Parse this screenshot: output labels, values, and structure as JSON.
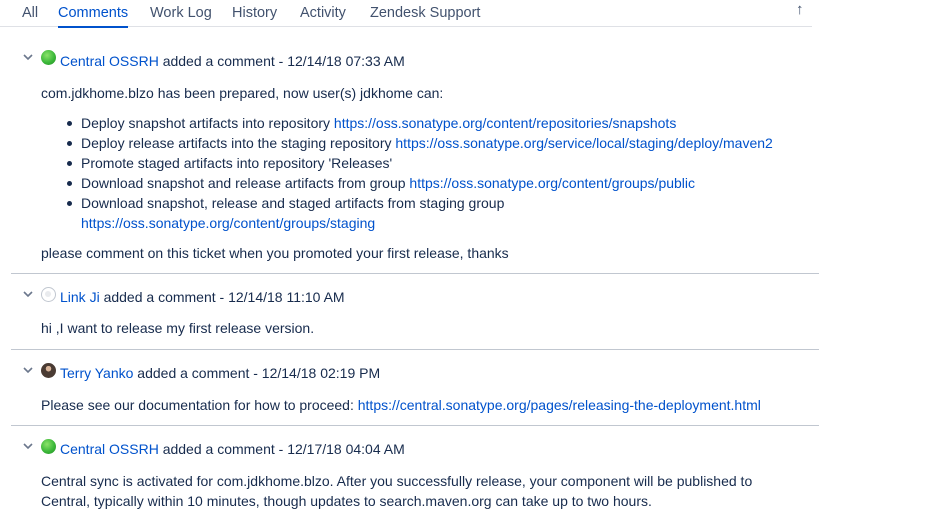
{
  "tabs": [
    {
      "label": "All"
    },
    {
      "label": "Comments"
    },
    {
      "label": "Work Log"
    },
    {
      "label": "History"
    },
    {
      "label": "Activity"
    },
    {
      "label": "Zendesk Support"
    }
  ],
  "sort_icon": "↑",
  "comments": [
    {
      "author": "Central OSSRH",
      "meta": "added a comment - 12/14/18 07:33 AM",
      "intro": "com.jdkhome.blzo has been prepared, now user(s) jdkhome can:",
      "items": [
        {
          "text": "Deploy snapshot artifacts into repository ",
          "link": "https://oss.sonatype.org/content/repositories/snapshots"
        },
        {
          "text": "Deploy release artifacts into the staging repository ",
          "link": "https://oss.sonatype.org/service/local/staging/deploy/maven2"
        },
        {
          "text": "Promote staged artifacts into repository 'Releases'",
          "link": ""
        },
        {
          "text": "Download snapshot and release artifacts from group ",
          "link": "https://oss.sonatype.org/content/groups/public"
        },
        {
          "text": "Download snapshot, release and staged artifacts from staging group",
          "link": "https://oss.sonatype.org/content/groups/staging"
        }
      ],
      "outro": "please comment on this ticket when you promoted your first release, thanks"
    },
    {
      "author": "Link Ji",
      "meta": "added a comment - 12/14/18 11:10 AM",
      "text": "hi ,I want to release my first release version."
    },
    {
      "author": "Terry Yanko",
      "meta": "added a comment - 12/14/18 02:19 PM",
      "text": "Please see our documentation for how to proceed: ",
      "link": "https://central.sonatype.org/pages/releasing-the-deployment.html"
    },
    {
      "author": "Central OSSRH",
      "meta": "added a comment - 12/17/18 04:04 AM",
      "line1": "Central sync is activated for com.jdkhome.blzo. After you successfully release, your component will be published to",
      "line2": "Central, typically within 10 minutes, though updates to search.maven.org can take up to two hours."
    }
  ]
}
